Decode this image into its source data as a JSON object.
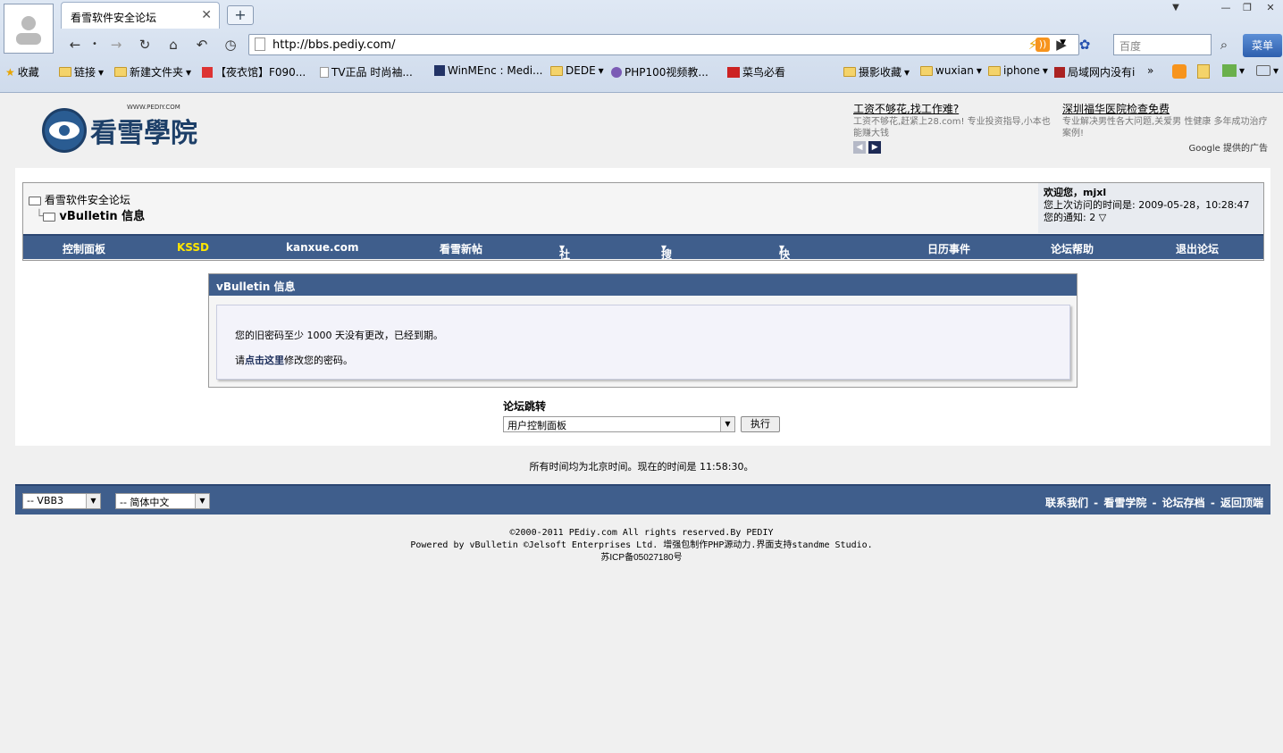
{
  "browser": {
    "tab_title": "看雪软件安全论坛",
    "address": "http://bbs.pediy.com/",
    "search_placeholder": "百度",
    "menu_label": "菜单"
  },
  "bookmarks": [
    "收藏",
    "链接",
    "新建文件夹",
    "【夜衣馆】F090...",
    "TV正品 时尚袖...",
    "WinMEnc : Medi...",
    "DEDE",
    "PHP100视频教...",
    "菜鸟必看",
    "摄影收藏",
    "wuxian",
    "iphone",
    "局域网内没有i"
  ],
  "header": {
    "logo_text": "看雪學院",
    "logo_small": "WWW.PEDIY.COM",
    "ad1_title": "工资不够花,找工作难?",
    "ad1_text": "工资不够花,赶紧上28.com! 专业投资指导,小本也能赚大钱",
    "ad2_title": "深圳福华医院检查免费",
    "ad2_text": "专业解决男性各大问题,关爱男 性健康 多年成功治疗案例!",
    "google_label": "Google 提供的广告"
  },
  "breadcrumb": {
    "root": "看雪软件安全论坛",
    "current": "vBulletin 信息"
  },
  "user": {
    "welcome": "欢迎您，mjxl",
    "last_visit": "您上次访问的时间是: 2009-05-28，10:28:47",
    "notices": "您的通知: 2"
  },
  "nav": [
    "控制面板",
    "KSSD",
    "kanxue.com",
    "看雪新帖",
    "社区",
    "搜索",
    "快速链接",
    "日历事件",
    "论坛帮助",
    "退出论坛"
  ],
  "message": {
    "title": "vBulletin 信息",
    "line1": "您的旧密码至少 1000 天没有更改，已经到期。",
    "line2_pre": "请",
    "line2_link": "点击这里",
    "line2_post": "修改您的密码。"
  },
  "jump": {
    "label": "论坛跳转",
    "selected": "用户控制面板",
    "button": "执行"
  },
  "time_text": "所有时间均为北京时间。现在的时间是 11:58:30。",
  "footer": {
    "style_select": "-- VBB3",
    "lang_select": "-- 简体中文",
    "links": "联系我们 - 看雪学院 - 论坛存档 - 返回顶端",
    "copy1": "©2000-2011 PEdiy.com All rights reserved.By PEDIY",
    "copy2": "Powered by vBulletin ©Jelsoft Enterprises Ltd. 增强包制作PHP源动力.界面支持standme Studio.",
    "copy3": "苏ICP备05027180号"
  }
}
